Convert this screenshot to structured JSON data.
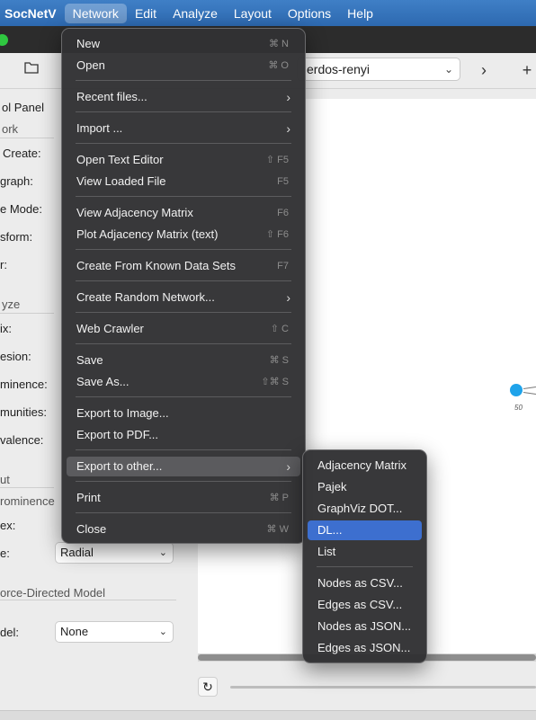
{
  "menubar": {
    "app": "SocNetV",
    "items": [
      "Network",
      "Edit",
      "Analyze",
      "Layout",
      "Options",
      "Help"
    ]
  },
  "toolbar": {
    "dataset_value": "erdos-renyi",
    "next_glyph": "›",
    "plus_glyph": "+"
  },
  "panel": {
    "title": "ol Panel",
    "network_section": "ork",
    "create_label": "Create:",
    "graph_label": "graph:",
    "mode_label": "e Mode:",
    "transform_label": "sform:",
    "filter_label": "r:",
    "analyze_section": "yze",
    "matrix_label": "ix:",
    "cohesion_label": "esion:",
    "prominence_label": "minence:",
    "communities_label": "munities:",
    "equivalence_label": "valence:",
    "layout_section": "ut",
    "prominence_sub": "rominence",
    "index_label": "ex:",
    "type_label": "e:",
    "type_value": "Radial",
    "force_section": "orce-Directed Model",
    "model_label": "del:",
    "model_value": "None"
  },
  "canvas": {
    "node_label": "50"
  },
  "network_menu": {
    "items": [
      {
        "label": "New",
        "shortcut": "⌘ N"
      },
      {
        "label": "Open",
        "shortcut": "⌘ O"
      },
      {
        "label": "Recent files...",
        "submenu": true
      },
      {
        "label": "Import ...",
        "submenu": true
      },
      {
        "label": "Open Text Editor",
        "shortcut": "⇧ F5"
      },
      {
        "label": "View Loaded File",
        "shortcut": "F5"
      },
      {
        "label": "View Adjacency Matrix",
        "shortcut": "F6"
      },
      {
        "label": "Plot Adjacency Matrix (text)",
        "shortcut": "⇧ F6"
      },
      {
        "label": "Create From Known Data Sets",
        "shortcut": "F7"
      },
      {
        "label": "Create Random Network...",
        "submenu": true
      },
      {
        "label": "Web Crawler",
        "shortcut": "⇧ C"
      },
      {
        "label": "Save",
        "shortcut": "⌘ S"
      },
      {
        "label": "Save As...",
        "shortcut": "⇧⌘ S"
      },
      {
        "label": "Export to Image...",
        "shortcut": ""
      },
      {
        "label": "Export to PDF...",
        "shortcut": ""
      },
      {
        "label": "Export to other...",
        "submenu": true
      },
      {
        "label": "Print",
        "shortcut": "⌘ P"
      },
      {
        "label": "Close",
        "shortcut": "⌘ W"
      }
    ]
  },
  "export_submenu": {
    "items": [
      "Adjacency Matrix",
      "Pajek",
      "GraphViz DOT...",
      "DL...",
      "List",
      "Nodes as CSV...",
      "Edges as CSV...",
      "Nodes as JSON...",
      "Edges as JSON..."
    ],
    "selected": "DL..."
  },
  "colors": {
    "menubar": "#2d69b0",
    "highlight": "#3d6fcf",
    "node": "#1fa3ea"
  }
}
